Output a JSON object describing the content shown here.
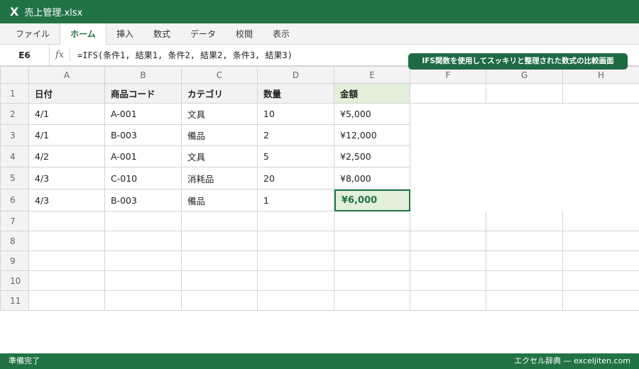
{
  "title": {
    "app_icon": "X",
    "filename": "売上管理.xlsx"
  },
  "ribbon": {
    "tabs": [
      "ファイル",
      "ホーム",
      "挿入",
      "数式",
      "データ",
      "校閲",
      "表示"
    ],
    "active": "ホーム"
  },
  "formula_bar": {
    "cell_ref": "E6",
    "fx_label": "fx",
    "formula": "=IFS(条件1, 結果1, 条件2, 結果2, 条件3, 結果3)"
  },
  "banner": "IFS関数を使用してスッキリと整理された数式の比較画面",
  "sheet": {
    "columns": [
      "A",
      "B",
      "C",
      "D",
      "E",
      "F",
      "G",
      "H"
    ],
    "rows": [
      "1",
      "2",
      "3",
      "4",
      "5",
      "6",
      "7",
      "8",
      "9",
      "10",
      "11"
    ],
    "header": [
      "日付",
      "商品コード",
      "カテゴリ",
      "数量",
      "金額"
    ],
    "data": [
      [
        "4/1",
        "A-001",
        "文具",
        "10",
        "¥5,000"
      ],
      [
        "4/1",
        "B-003",
        "備品",
        "2",
        "¥12,000"
      ],
      [
        "4/2",
        "A-001",
        "文具",
        "5",
        "¥2,500"
      ],
      [
        "4/3",
        "C-010",
        "消耗品",
        "20",
        "¥8,000"
      ],
      [
        "4/3",
        "B-003",
        "備品",
        "1",
        "¥6,000"
      ]
    ],
    "selected_cell": "E6"
  },
  "status": {
    "left": "準備完了",
    "right": "エクセル辞典 ― exceljiten.com"
  },
  "colors": {
    "accent": "#217346",
    "highlight": "#e2efda",
    "banner": "#1e6b43"
  }
}
